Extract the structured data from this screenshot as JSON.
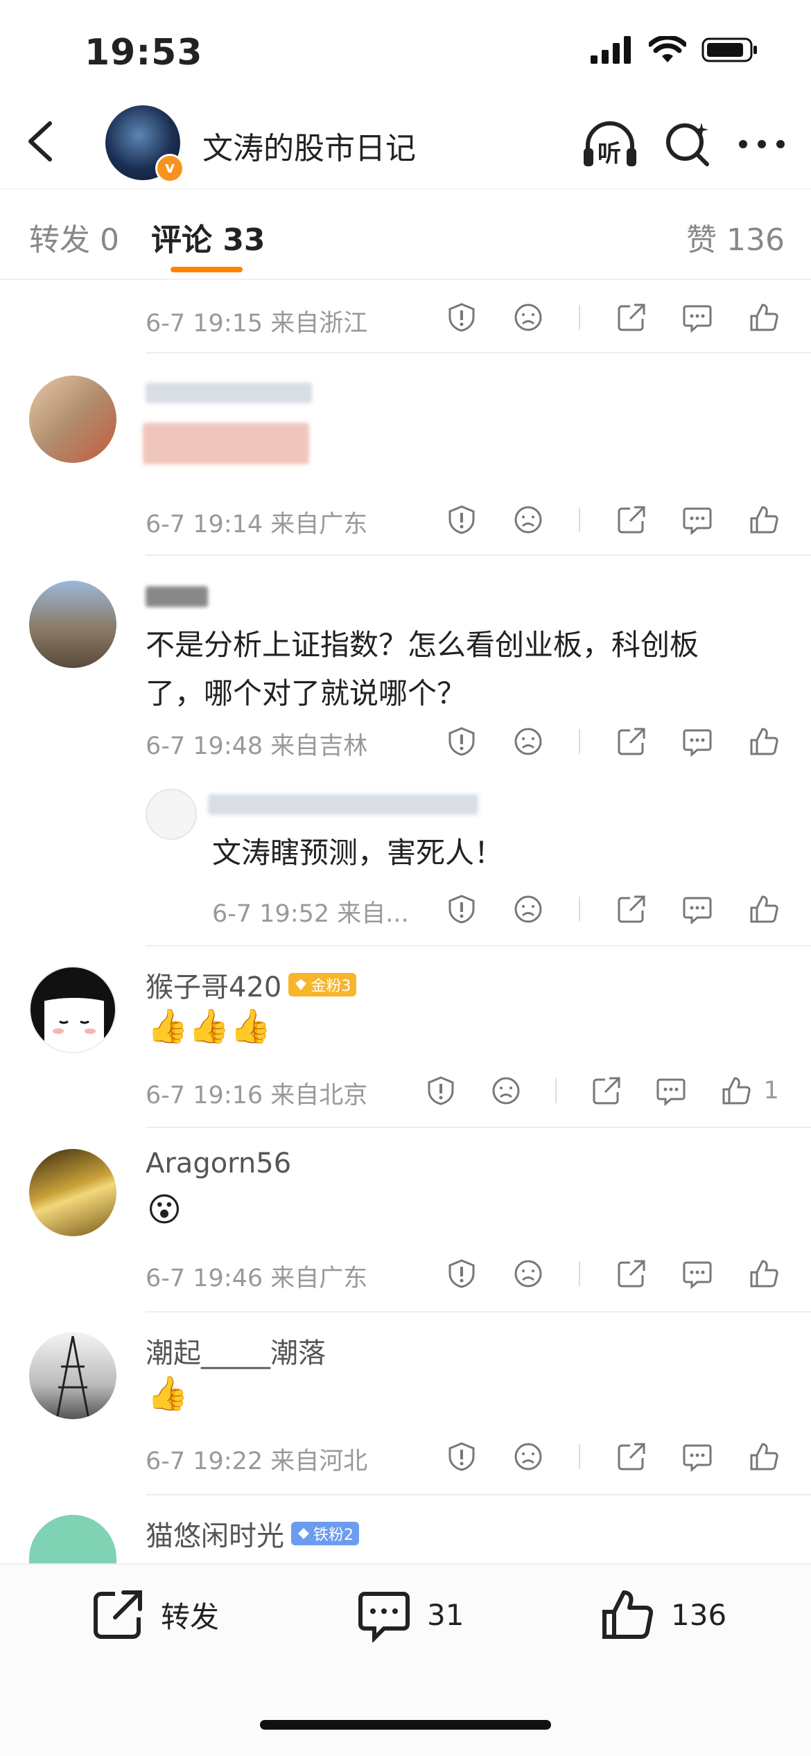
{
  "status": {
    "time": "19:53"
  },
  "header": {
    "title": "文涛的股市日记",
    "listen_label": "听"
  },
  "tabs": [
    {
      "label": "转发 0"
    },
    {
      "label": "评论 33"
    },
    {
      "label": "赞 136"
    }
  ],
  "comments": {
    "c0": {
      "meta": "6-7 19:15 来自浙江"
    },
    "c1": {
      "meta": "6-7 19:14 来自广东"
    },
    "c2": {
      "text": "不是分析上证指数？怎么看创业板，科创板了，哪个对了就说哪个？",
      "meta": "6-7 19:48 来自吉林",
      "reply": {
        "text": "文涛瞎预测，害死人！",
        "meta": "6-7 19:52 来自..."
      }
    },
    "c3": {
      "name": "猴子哥420",
      "badge": "金粉3",
      "emoji": "👍👍👍",
      "meta": "6-7 19:16 来自北京",
      "likes": "1"
    },
    "c4": {
      "name": "Aragorn56",
      "emoji": "😮",
      "meta": "6-7 19:46 来自广东"
    },
    "c5": {
      "name": "潮起_____潮落",
      "emoji": "👍",
      "meta": "6-7 19:22 来自河北"
    },
    "c6": {
      "name": "猫悠闲时光",
      "badge": "铁粉2"
    }
  },
  "bottom": {
    "repost_label": "转发",
    "comment_count": "31",
    "like_count": "136"
  },
  "colors": {
    "accent": "#ff8200",
    "gold_badge": "#f7b52c",
    "iron_badge": "#6b9cf0"
  }
}
